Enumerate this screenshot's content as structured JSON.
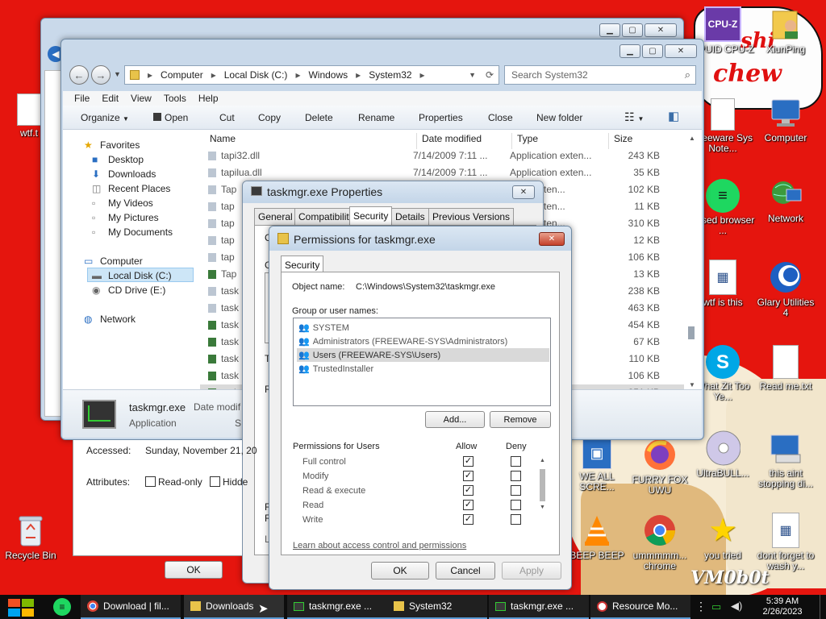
{
  "desktop": {
    "art_text_1": "shi",
    "art_text_2": "chew",
    "art_text_3": "VM0b0t",
    "icons": [
      {
        "label": "wtf.t",
        "icon": "document-icon"
      },
      {
        "label": "Recycle Bin",
        "icon": "recycle-bin-icon"
      },
      {
        "label": "CPUID CPU-Z",
        "icon": "cpuz-icon"
      },
      {
        "label": "XiunPing",
        "icon": "user-folder-icon"
      },
      {
        "label": "Freeware Sys Note...",
        "icon": "document-icon"
      },
      {
        "label": "Computer",
        "icon": "computer-icon"
      },
      {
        "label": "based browser ...",
        "icon": "spotify-icon"
      },
      {
        "label": "Network",
        "icon": "network-icon"
      },
      {
        "label": "wtf is this",
        "icon": "calendar-doc-icon"
      },
      {
        "label": "Glary Utilities 4",
        "icon": "glary-icon"
      },
      {
        "label": "What Zit Too Ye...",
        "icon": "skype-icon"
      },
      {
        "label": "Read me.txt",
        "icon": "document-icon"
      },
      {
        "label": "WE ALL SCRE...",
        "icon": "app-icon"
      },
      {
        "label": "FURRY FOX UWU",
        "icon": "firefox-icon"
      },
      {
        "label": "UltraBULL...",
        "icon": "disc-icon"
      },
      {
        "label": "this aint stopping di...",
        "icon": "installer-icon"
      },
      {
        "label": "BEEP BEEP",
        "icon": "vlc-icon"
      },
      {
        "label": "ummmmm... chrome",
        "icon": "chrome-icon"
      },
      {
        "label": "you tried",
        "icon": "star-icon"
      },
      {
        "label": "dont forget to wash y...",
        "icon": "calendar-doc-icon"
      }
    ]
  },
  "explorer": {
    "breadcrumb": [
      "Computer",
      "Local Disk (C:)",
      "Windows",
      "System32"
    ],
    "search_placeholder": "Search System32",
    "menu": [
      "File",
      "Edit",
      "View",
      "Tools",
      "Help"
    ],
    "toolbar": [
      "Organize",
      "Open",
      "Cut",
      "Copy",
      "Delete",
      "Rename",
      "Properties",
      "Close",
      "New folder"
    ],
    "nav": {
      "favorites": "Favorites",
      "fav_items": [
        "Desktop",
        "Downloads",
        "Recent Places",
        "My Videos",
        "My Pictures",
        "My Documents"
      ],
      "computer": "Computer",
      "drives": [
        "Local Disk (C:)",
        "CD Drive (E:)"
      ],
      "network": "Network"
    },
    "columns": {
      "name": "Name",
      "date": "Date modified",
      "type": "Type",
      "size": "Size"
    },
    "files": [
      {
        "name": "tapi32.dll",
        "date": "7/14/2009 7:11 ...",
        "type": "Application exten...",
        "size": "243 KB"
      },
      {
        "name": "tapilua.dll",
        "date": "7/14/2009 7:11 ...",
        "type": "Application exten...",
        "size": "35 KB"
      },
      {
        "name": "Tap",
        "date": "",
        "type": "ation exten...",
        "size": "102 KB"
      },
      {
        "name": "tap",
        "date": "",
        "type": "ation exten...",
        "size": "11 KB"
      },
      {
        "name": "tap",
        "date": "",
        "type": "ation exten...",
        "size": "310 KB"
      },
      {
        "name": "tap",
        "date": "",
        "type": "ation exten...",
        "size": "12 KB"
      },
      {
        "name": "tap",
        "date": "",
        "type": "ation exten...",
        "size": "106 KB"
      },
      {
        "name": "Tap",
        "date": "",
        "type": "",
        "size": "13 KB"
      },
      {
        "name": "task",
        "date": "",
        "type": "ation exten...",
        "size": "238 KB"
      },
      {
        "name": "task",
        "date": "",
        "type": "ation exten...",
        "size": "463 KB"
      },
      {
        "name": "task",
        "date": "",
        "type": "",
        "size": "454 KB"
      },
      {
        "name": "task",
        "date": "",
        "type": "",
        "size": "67 KB"
      },
      {
        "name": "task",
        "date": "",
        "type": "",
        "size": "110 KB"
      },
      {
        "name": "task",
        "date": "",
        "type": "",
        "size": "106 KB"
      },
      {
        "name": "task",
        "date": "",
        "type": "",
        "size": "251 KB"
      }
    ],
    "details": {
      "name": "taskmgr.exe",
      "date_label": "Date modif",
      "type": "Application",
      "s": "S"
    }
  },
  "properties": {
    "title": "taskmgr.exe Properties",
    "tabs": [
      "General",
      "Compatibility",
      "Security",
      "Details",
      "Previous Versions"
    ],
    "accessed_label": "Accessed:",
    "accessed_value": "Sunday, November 21, 20",
    "attributes_label": "Attributes:",
    "readonly_label": "Read-only",
    "hidden_label": "Hidde",
    "ok": "OK",
    "frag_c": "C",
    "frag_g": "G",
    "frag_t": "T",
    "frag_r": "R",
    "frag_f": "F",
    "frag_r2": "R",
    "frag_l": "L"
  },
  "permissions": {
    "title": "Permissions for taskmgr.exe",
    "tab": "Security",
    "object_label": "Object name:",
    "object_value": "C:\\Windows\\System32\\taskmgr.exe",
    "group_label": "Group or user names:",
    "groups": [
      "SYSTEM",
      "Administrators (FREEWARE-SYS\\Administrators)",
      "Users (FREEWARE-SYS\\Users)",
      "TrustedInstaller"
    ],
    "add": "Add...",
    "remove": "Remove",
    "perm_label": "Permissions for Users",
    "allow": "Allow",
    "deny": "Deny",
    "perms": [
      {
        "name": "Full control",
        "allow": true,
        "deny": false
      },
      {
        "name": "Modify",
        "allow": true,
        "deny": false
      },
      {
        "name": "Read & execute",
        "allow": true,
        "deny": false
      },
      {
        "name": "Read",
        "allow": true,
        "deny": false
      },
      {
        "name": "Write",
        "allow": true,
        "deny": false
      }
    ],
    "link": "Learn about access control and permissions",
    "ok": "OK",
    "cancel": "Cancel",
    "apply": "Apply"
  },
  "taskbar": {
    "items": [
      {
        "label": "Download | fil...",
        "icon": "chrome-icon"
      },
      {
        "label": "Downloads",
        "icon": "folder-icon"
      },
      {
        "label": "taskmgr.exe ...",
        "icon": "taskmgr-icon"
      },
      {
        "label": "System32",
        "icon": "folder-icon"
      },
      {
        "label": "taskmgr.exe ...",
        "icon": "taskmgr-icon"
      },
      {
        "label": "Resource Mo...",
        "icon": "resource-monitor-icon"
      }
    ],
    "time": "5:39 AM",
    "date": "2/26/2023"
  }
}
